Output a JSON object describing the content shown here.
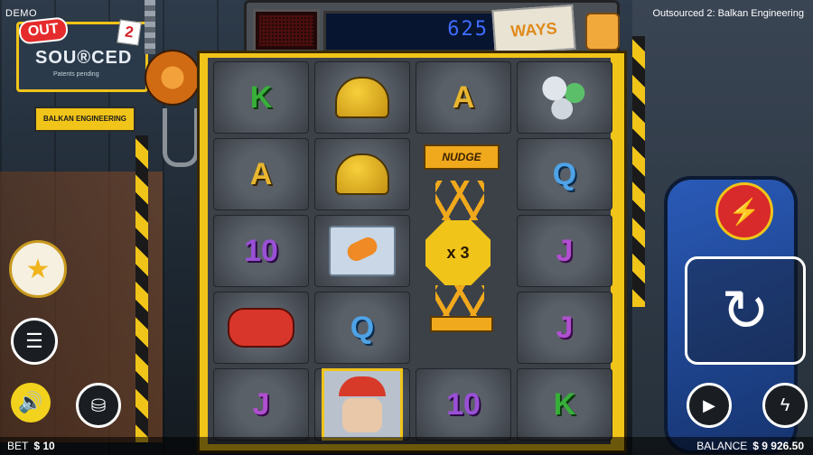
{
  "header": {
    "mode": "DEMO",
    "game_title": "Outsourced 2: Balkan Engineering"
  },
  "logo": {
    "badge": "OUT",
    "main": "SOU®CED",
    "tagline": "Patents pending",
    "number": "2",
    "subtitle": "BALKAN ENGINEERING"
  },
  "ways": {
    "count": "625",
    "label": "WAYS"
  },
  "reels": {
    "rows": [
      [
        {
          "type": "K",
          "label": "K"
        },
        {
          "type": "helmet",
          "label": ""
        },
        {
          "type": "A",
          "label": "A"
        },
        {
          "type": "cans",
          "label": ""
        }
      ],
      [
        {
          "type": "A",
          "label": "A"
        },
        {
          "type": "helmet",
          "label": ""
        },
        {
          "type": "nudge",
          "label": ""
        },
        {
          "type": "Q",
          "label": "Q"
        }
      ],
      [
        {
          "type": "TEN",
          "label": "10"
        },
        {
          "type": "glovebag",
          "label": ""
        },
        {
          "type": "mult",
          "label": ""
        },
        {
          "type": "J",
          "label": "J"
        }
      ],
      [
        {
          "type": "controller",
          "label": ""
        },
        {
          "type": "Q",
          "label": "Q"
        },
        {
          "type": "lift",
          "label": ""
        },
        {
          "type": "J",
          "label": "J"
        }
      ],
      [
        {
          "type": "J",
          "label": "J"
        },
        {
          "type": "worker",
          "label": ""
        },
        {
          "type": "TEN",
          "label": "10"
        },
        {
          "type": "K",
          "label": "K"
        }
      ]
    ],
    "nudge_label": "NUDGE",
    "multiplier": "x 3"
  },
  "footer": {
    "bet_label": "BET",
    "bet_value": "$ 10",
    "balance_label": "BALANCE",
    "balance_value": "$ 9 926.50"
  },
  "icons": {
    "favorite": "star-icon",
    "menu": "hamburger-menu-icon",
    "sound": "speaker-icon",
    "bet": "coin-stack-icon",
    "turbo": "lightning-icon",
    "spin": "spin-arrow-icon",
    "autoplay": "play-icon",
    "quickspin": "lightning-icon"
  },
  "colors": {
    "hazard_yellow": "#f0c419",
    "ways_blue": "#3f6cff",
    "turbo_red": "#d82a2a"
  }
}
